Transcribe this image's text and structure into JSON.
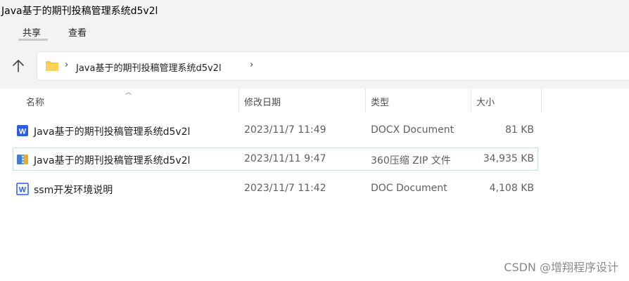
{
  "window": {
    "title": "Java基于的期刊投稿管理系统d5v2l"
  },
  "ribbon": {
    "tabs": [
      {
        "label": "共享"
      },
      {
        "label": "查看"
      }
    ]
  },
  "address": {
    "crumb": "Java基于的期刊投稿管理系统d5v2l",
    "separator": "›"
  },
  "columns": {
    "name": "名称",
    "date": "修改日期",
    "type": "类型",
    "size": "大小"
  },
  "files": [
    {
      "name": "Java基于的期刊投稿管理系统d5v2l",
      "date": "2023/11/7 11:49",
      "type": "DOCX Document",
      "size": "81 KB",
      "icon": "word-document-icon"
    },
    {
      "name": "Java基于的期刊投稿管理系统d5v2l",
      "date": "2023/11/11 9:47",
      "type": "360压缩 ZIP 文件",
      "size": "34,935 KB",
      "icon": "zip-archive-icon"
    },
    {
      "name": "ssm开发环境说明",
      "date": "2023/11/7 11:42",
      "type": "DOC Document",
      "size": "4,108 KB",
      "icon": "word-document-icon"
    }
  ],
  "watermark": "CSDN @增翔程序设计",
  "colors": {
    "folder": "#f8c843",
    "word": "#2b5ce6",
    "selection_border": "#c7dfe6"
  }
}
